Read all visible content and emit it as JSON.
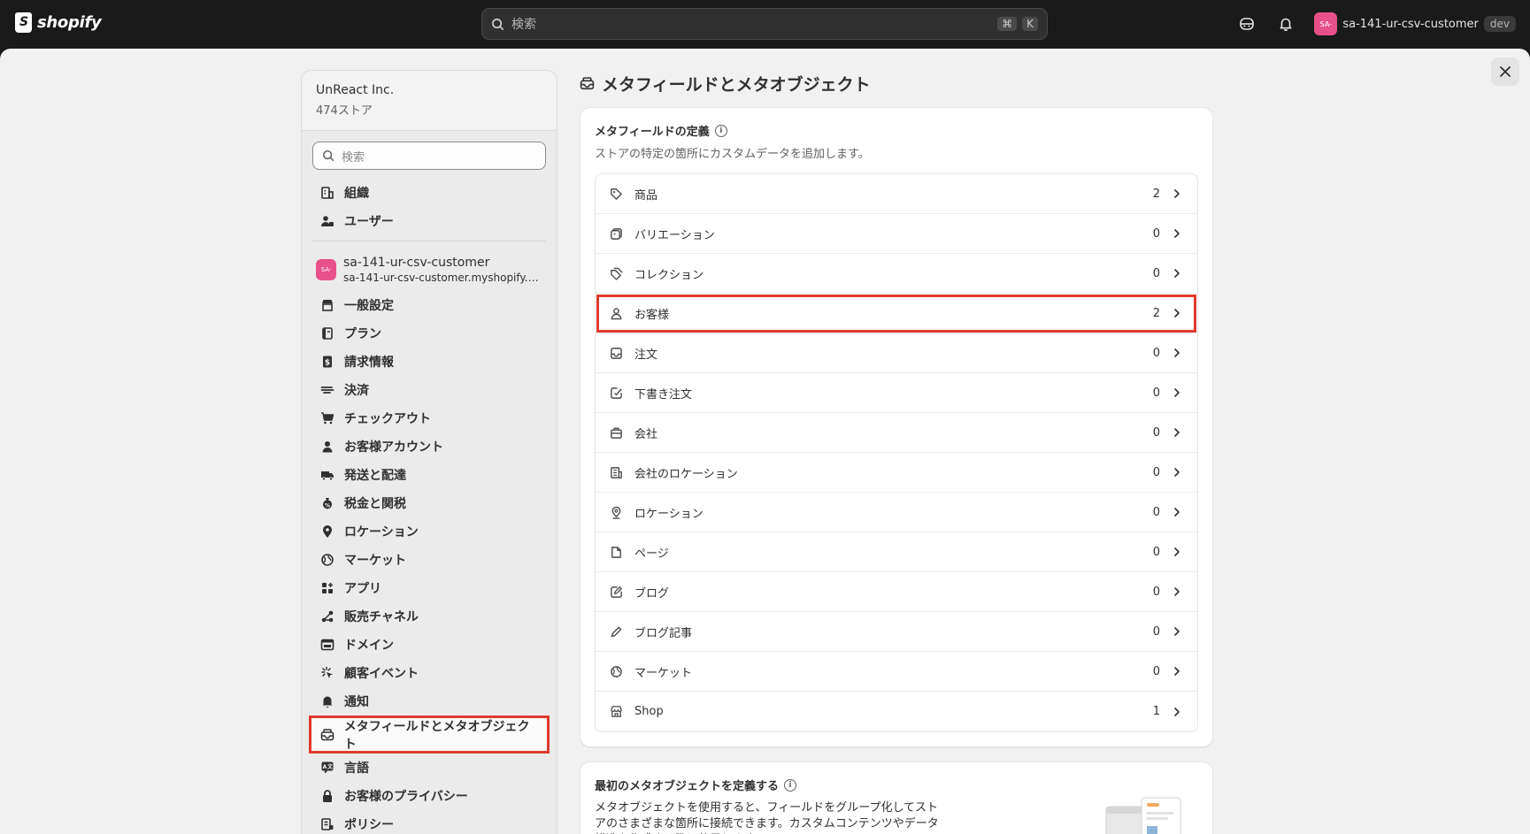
{
  "topbar": {
    "logo_text": "shopify",
    "search_placeholder": "検索",
    "shortcut_key1": "⌘",
    "shortcut_key2": "K",
    "store_avatar": "SA-",
    "store_name": "sa-141-ur-csv-customer",
    "env_badge": "dev"
  },
  "sidebar": {
    "org_name": "UnReact Inc.",
    "org_count": "474ストア",
    "search_placeholder": "検索",
    "top_items": [
      {
        "label": "組織",
        "icon": "building-icon"
      },
      {
        "label": "ユーザー",
        "icon": "users-icon"
      }
    ],
    "store": {
      "avatar": "SA-",
      "name": "sa-141-ur-csv-customer",
      "domain": "sa-141-ur-csv-customer.myshopify.c..."
    },
    "items": [
      {
        "label": "一般設定",
        "icon": "store-icon"
      },
      {
        "label": "プラン",
        "icon": "plan-icon"
      },
      {
        "label": "請求情報",
        "icon": "billing-icon"
      },
      {
        "label": "決済",
        "icon": "payments-icon"
      },
      {
        "label": "チェックアウト",
        "icon": "cart-icon"
      },
      {
        "label": "お客様アカウント",
        "icon": "person-icon"
      },
      {
        "label": "発送と配達",
        "icon": "truck-icon"
      },
      {
        "label": "税金と関税",
        "icon": "tax-icon"
      },
      {
        "label": "ロケーション",
        "icon": "location-icon"
      },
      {
        "label": "マーケット",
        "icon": "globe-icon"
      },
      {
        "label": "アプリ",
        "icon": "apps-icon"
      },
      {
        "label": "販売チャネル",
        "icon": "channels-icon"
      },
      {
        "label": "ドメイン",
        "icon": "domain-icon"
      },
      {
        "label": "顧客イベント",
        "icon": "events-icon"
      },
      {
        "label": "通知",
        "icon": "bell-icon"
      },
      {
        "label": "メタフィールドとメタオブジェクト",
        "icon": "metafields-icon"
      },
      {
        "label": "言語",
        "icon": "language-icon"
      },
      {
        "label": "お客様のプライバシー",
        "icon": "lock-icon"
      },
      {
        "label": "ポリシー",
        "icon": "policy-icon"
      }
    ]
  },
  "content": {
    "title": "メタフィールドとメタオブジェクト",
    "definitions_card": {
      "title": "メタフィールドの定義",
      "subtitle": "ストアの特定の箇所にカスタムデータを追加します。",
      "rows": [
        {
          "label": "商品",
          "count": "2",
          "icon": "tag-icon"
        },
        {
          "label": "バリエーション",
          "count": "0",
          "icon": "variant-icon"
        },
        {
          "label": "コレクション",
          "count": "0",
          "icon": "collection-icon"
        },
        {
          "label": "お客様",
          "count": "2",
          "icon": "person-icon"
        },
        {
          "label": "注文",
          "count": "0",
          "icon": "inbox-icon"
        },
        {
          "label": "下書き注文",
          "count": "0",
          "icon": "draft-order-icon"
        },
        {
          "label": "会社",
          "count": "0",
          "icon": "company-icon"
        },
        {
          "label": "会社のロケーション",
          "count": "0",
          "icon": "building-icon"
        },
        {
          "label": "ロケーション",
          "count": "0",
          "icon": "location-icon"
        },
        {
          "label": "ページ",
          "count": "0",
          "icon": "page-icon"
        },
        {
          "label": "ブログ",
          "count": "0",
          "icon": "blog-icon"
        },
        {
          "label": "ブログ記事",
          "count": "0",
          "icon": "pencil-icon"
        },
        {
          "label": "マーケット",
          "count": "0",
          "icon": "globe-icon"
        },
        {
          "label": "Shop",
          "count": "1",
          "icon": "shop-icon"
        }
      ]
    },
    "metaobject_card": {
      "title": "最初のメタオブジェクトを定義する",
      "text": "メタオブジェクトを使用すると、フィールドをグループ化してストアのさまざまな箇所に接続できます。カスタムコンテンツやデータ構造を作成する際に使用します。"
    }
  },
  "colors": {
    "highlight": "#e03a2f",
    "avatar": "#e8508a"
  }
}
